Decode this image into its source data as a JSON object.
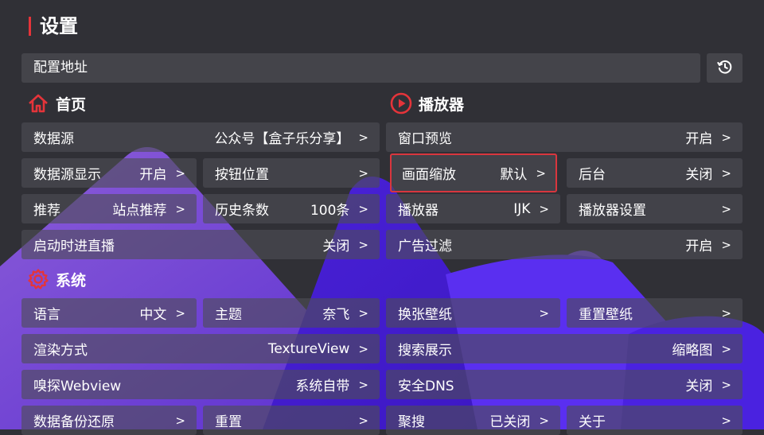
{
  "title": "设置",
  "config": {
    "label": "配置地址"
  },
  "colors": {
    "accent": "#e5343a",
    "background": "#303036",
    "highlight_border": "#d9363e",
    "mountain": "#5b2ff0"
  },
  "icons": {
    "history": "history-icon",
    "home": "home-icon",
    "player": "play-circle-icon",
    "system": "gear-icon",
    "chevron": ">"
  },
  "home": {
    "title": "首页",
    "data_source": {
      "label": "数据源",
      "value": "公众号【盒子乐分享】",
      "chevron": ">"
    },
    "data_source_display": {
      "label": "数据源显示",
      "value": "开启",
      "chevron": ">"
    },
    "button_position": {
      "label": "按钮位置",
      "value": "",
      "chevron": ">"
    },
    "recommend": {
      "label": "推荐",
      "value": "站点推荐",
      "chevron": ">"
    },
    "history_count": {
      "label": "历史条数",
      "value": "100条",
      "chevron": ">"
    },
    "startup_live": {
      "label": "启动时进直播",
      "value": "关闭",
      "chevron": ">"
    }
  },
  "player": {
    "title": "播放器",
    "window_preview": {
      "label": "窗口预览",
      "value": "开启",
      "chevron": ">"
    },
    "scaling": {
      "label": "画面缩放",
      "value": "默认",
      "chevron": ">"
    },
    "background": {
      "label": "后台",
      "value": "关闭",
      "chevron": ">"
    },
    "player": {
      "label": "播放器",
      "value": "IJK",
      "chevron": ">"
    },
    "player_settings": {
      "label": "播放器设置",
      "value": "",
      "chevron": ">"
    },
    "ad_filter": {
      "label": "广告过滤",
      "value": "开启",
      "chevron": ">"
    }
  },
  "system": {
    "title": "系统",
    "language": {
      "label": "语言",
      "value": "中文",
      "chevron": ">"
    },
    "theme": {
      "label": "主题",
      "value": "奈飞",
      "chevron": ">"
    },
    "render": {
      "label": "渲染方式",
      "value": "TextureView",
      "chevron": ">"
    },
    "sniff": {
      "label": "嗅探Webview",
      "value": "系统自带",
      "chevron": ">"
    },
    "backup": {
      "label": "数据备份还原",
      "value": "",
      "chevron": ">"
    },
    "reset": {
      "label": "重置",
      "value": "",
      "chevron": ">"
    },
    "change_wallpaper": {
      "label": "换张壁纸",
      "value": "",
      "chevron": ">"
    },
    "reset_wallpaper": {
      "label": "重置壁纸",
      "value": "",
      "chevron": ">"
    },
    "search_display": {
      "label": "搜索展示",
      "value": "缩略图",
      "chevron": ">"
    },
    "secure_dns": {
      "label": "安全DNS",
      "value": "关闭",
      "chevron": ">"
    },
    "aggregate_search": {
      "label": "聚搜",
      "value": "已关闭",
      "chevron": ">"
    },
    "about": {
      "label": "关于",
      "value": "",
      "chevron": ">"
    }
  }
}
